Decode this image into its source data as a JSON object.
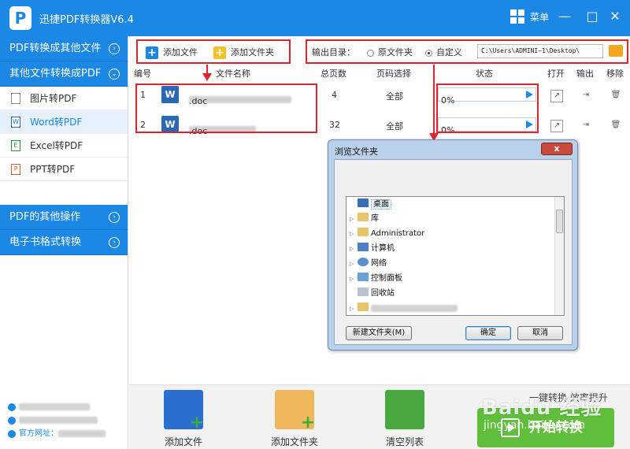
{
  "app": {
    "title": "迅捷PDF转换器V6.4",
    "logo": "P",
    "menu_label": "菜单"
  },
  "window": {
    "minimize": "—",
    "maximize": "□",
    "close": "✕"
  },
  "sidebar": {
    "categories": [
      {
        "label": "PDF转换成其他文件",
        "chevron": "›"
      },
      {
        "label": "其他文件转换成PDF",
        "chevron": "⌄"
      },
      {
        "label": "PDF的其他操作",
        "chevron": "›"
      },
      {
        "label": "电子书格式转换",
        "chevron": "›"
      }
    ],
    "items": [
      {
        "label": "图片转PDF",
        "icon": "image-icon"
      },
      {
        "label": "Word转PDF",
        "icon": "word-icon",
        "active": true
      },
      {
        "label": "Excel转PDF",
        "icon": "excel-icon"
      },
      {
        "label": "PPT转PDF",
        "icon": "ppt-icon"
      }
    ],
    "footer": {
      "website_label": "官方网址："
    }
  },
  "toolbar": {
    "add_file": "添加文件",
    "add_folder": "添加文件夹",
    "output_label": "输出目录：",
    "radio_original": "原文件夹",
    "radio_custom": "自定义",
    "output_path": "C:\\Users\\ADMINI~1\\Desktop\\"
  },
  "table": {
    "headers": {
      "index": "编号",
      "name": "文件名称",
      "pages": "总页数",
      "page_select": "页码选择",
      "status": "状态",
      "open": "打开",
      "output": "输出",
      "remove": "移除"
    },
    "rows": [
      {
        "index": "1",
        "name_suffix": ".doc",
        "pages": "4",
        "page_select": "全部",
        "progress": "0%"
      },
      {
        "index": "2",
        "name_suffix": ".doc",
        "pages": "32",
        "page_select": "全部",
        "progress": "0%"
      }
    ],
    "word_icon_letter": "W"
  },
  "dialog": {
    "title": "浏览文件夹",
    "close_glyph": "x",
    "tree": [
      {
        "label": "桌面",
        "selected": true
      },
      {
        "label": "库"
      },
      {
        "label": "Administrator"
      },
      {
        "label": "计算机"
      },
      {
        "label": "网络"
      },
      {
        "label": "控制面板"
      },
      {
        "label": "回收站"
      }
    ],
    "new_folder_button": "新建文件夹(M)",
    "ok_button": "确定",
    "cancel_button": "取消"
  },
  "bottom": {
    "add_file": "添加文件",
    "add_folder": "添加文件夹",
    "clear_list": "清空列表",
    "slogan": "一键转换  效率提升",
    "start": "开始转换"
  },
  "watermark": {
    "main": "Baidu 经验",
    "sub": "jingyan.baidu.com"
  },
  "colors": {
    "brand_blue": "#1a88e4",
    "highlight_red": "#e0232d",
    "start_green": "#5fbe3c"
  }
}
